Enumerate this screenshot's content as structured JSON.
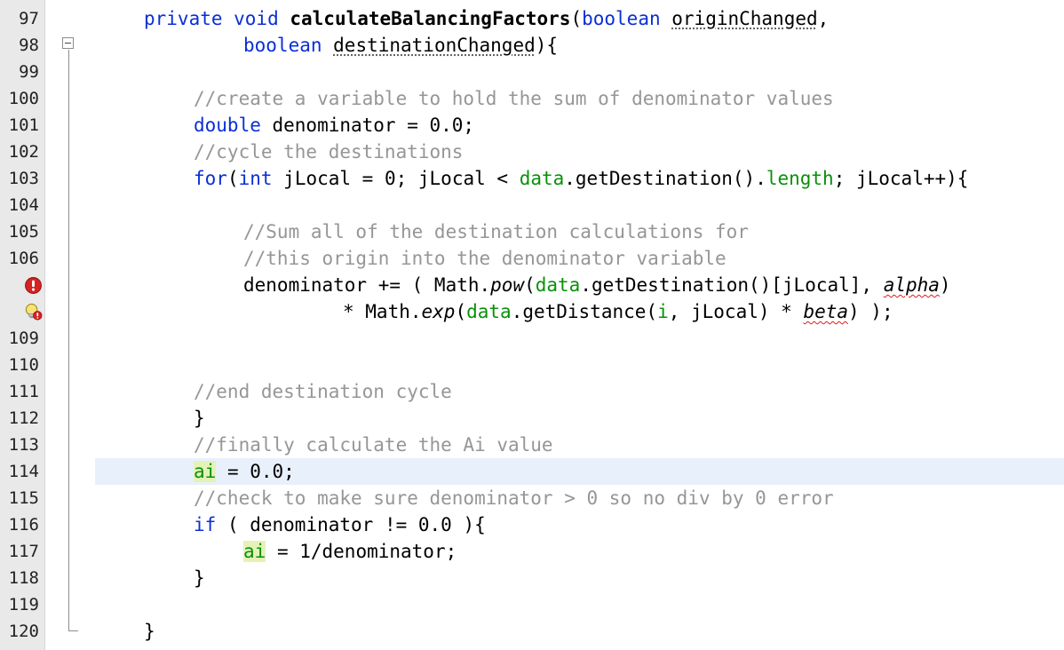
{
  "gutter": {
    "line_numbers": [
      "97",
      "98",
      "99",
      "100",
      "101",
      "102",
      "103",
      "104",
      "105",
      "106",
      "",
      "",
      "109",
      "110",
      "111",
      "112",
      "113",
      "114",
      "115",
      "116",
      "117",
      "118",
      "119",
      "120"
    ]
  },
  "code": {
    "l97": {
      "kw1": "private void ",
      "name": "calculateBalancingFactors",
      "paren": "(",
      "kw2": "boolean ",
      "param": "originChanged",
      "tail": ","
    },
    "l98": {
      "kw": "boolean ",
      "param": "destinationChanged",
      "tail": "){"
    },
    "l100": {
      "comment": "//create a variable to hold the sum of denominator values"
    },
    "l101": {
      "kw": "double",
      "rest": " denominator = 0.0;"
    },
    "l102": {
      "comment": "//cycle the destinations"
    },
    "l103": {
      "kw1": "for",
      "p1": "(",
      "kw2": "int",
      "p2": " jLocal = 0; jLocal < ",
      "f1": "data",
      "p3": ".getDestination().",
      "f2": "length",
      "p4": "; jLocal++){"
    },
    "l105": {
      "comment": "//Sum all of the destination calculations for"
    },
    "l106": {
      "comment": "//this origin into the denominator variable"
    },
    "l107": {
      "p1": "denominator += ( Math.",
      "m1": "pow",
      "p2": "(",
      "f1": "data",
      "p3": ".getDestination()[jLocal], ",
      "v1": "alpha",
      "p4": ")"
    },
    "l108": {
      "p1": "* Math.",
      "m1": "exp",
      "p2": "(",
      "f1": "data",
      "p3": ".getDistance(",
      "f2": "i",
      "p4": ", jLocal) * ",
      "v1": "beta",
      "p5": ") );"
    },
    "l111": {
      "comment": "//end destination cycle"
    },
    "l112": {
      "text": "}"
    },
    "l113": {
      "comment": "//finally calculate the Ai value"
    },
    "l114": {
      "field": "ai",
      "rest": " = 0.0;"
    },
    "l115": {
      "comment": "//check to make sure denominator > 0 so no div by 0 error"
    },
    "l116": {
      "kw": "if",
      "rest": " ( denominator != 0.0 ){"
    },
    "l117": {
      "field": "ai",
      "rest": " = 1/denominator;"
    },
    "l118": {
      "text": "}"
    },
    "l120": {
      "text": "}"
    }
  },
  "icons": {
    "error": "error-icon",
    "warning_bulb": "hint-bulb-error-icon",
    "fold": "fold-collapse-icon"
  },
  "colors": {
    "keyword": "#0a2fd6",
    "comment": "#969696",
    "field": "#099109",
    "current_line": "#e8f0fb",
    "occurrence_highlight": "#e4f2b8",
    "error": "#e01a1a"
  }
}
